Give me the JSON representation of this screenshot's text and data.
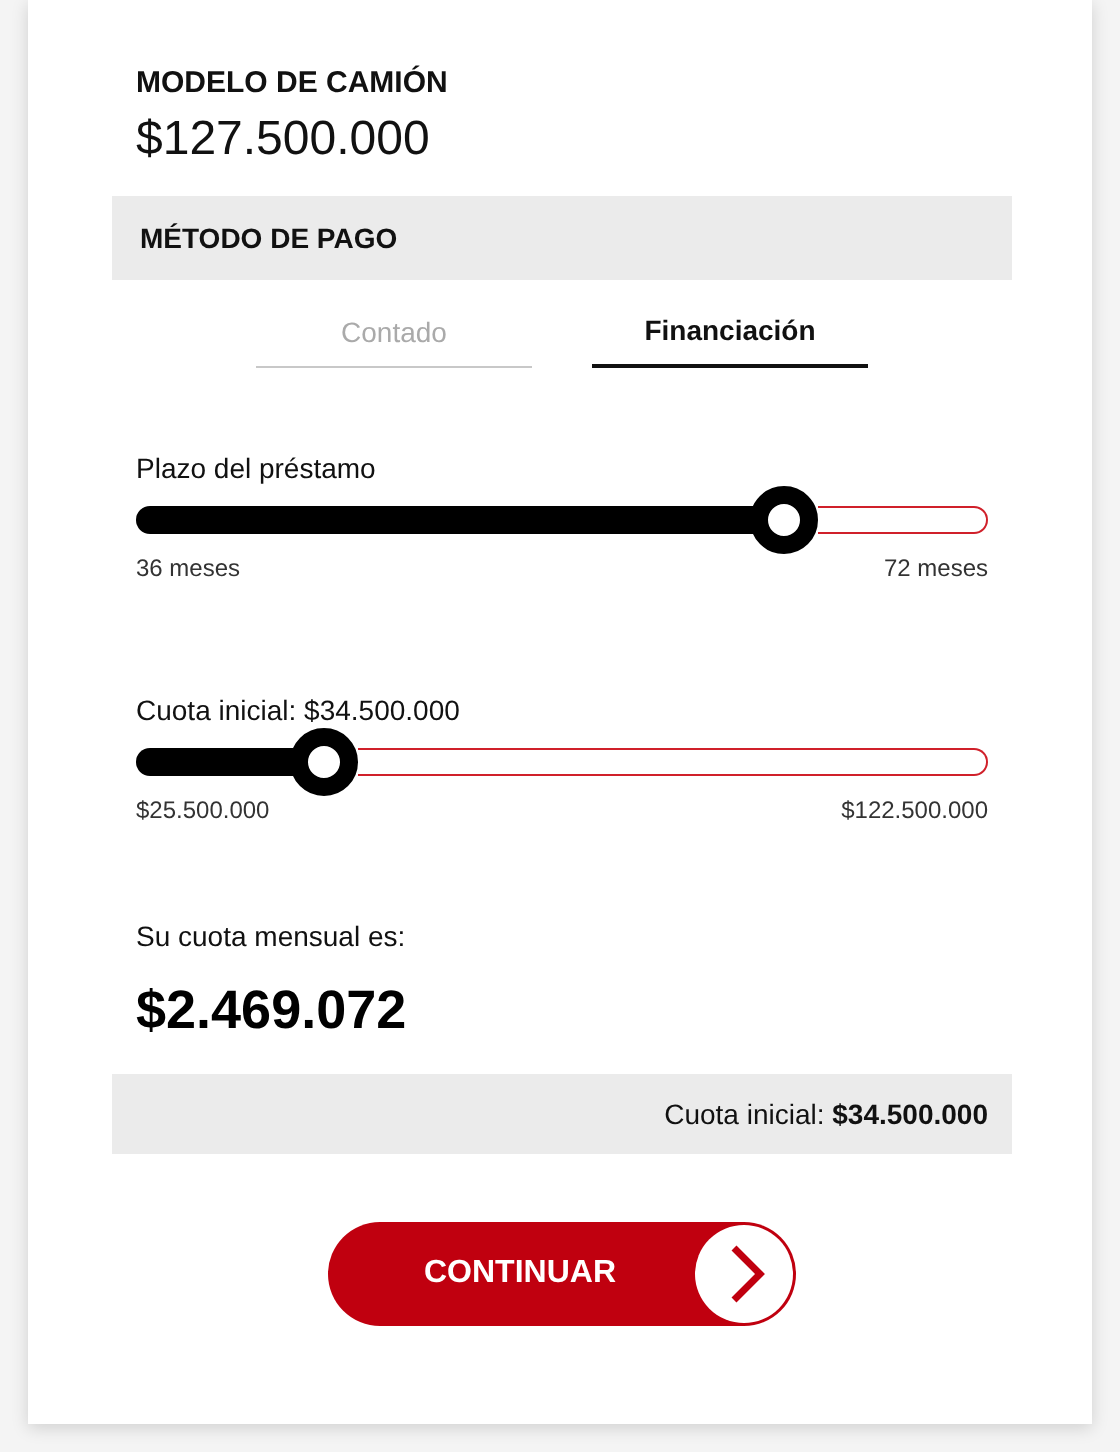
{
  "truck": {
    "label": "MODELO DE CAMIÓN",
    "price": "$127.500.000"
  },
  "payment_method": {
    "title": "MÉTODO DE PAGO"
  },
  "tabs": [
    {
      "label": "Contado",
      "selected": false
    },
    {
      "label": "Financiación",
      "selected": true
    }
  ],
  "sliders": [
    {
      "label": "Plazo del préstamo",
      "level": 0.76,
      "min": "36 meses",
      "max": "72 meses"
    },
    {
      "label": "Cuota inicial: $34.500.000",
      "level": 0.22,
      "min": "$25.500.000",
      "max": "$122.500.000"
    }
  ],
  "monthly": {
    "label": "Su cuota mensual es:",
    "amount": "$2.469.072"
  },
  "summary": "Cuota inicial: **$34.500.000**",
  "button": {
    "label": "CONTINUAR"
  }
}
